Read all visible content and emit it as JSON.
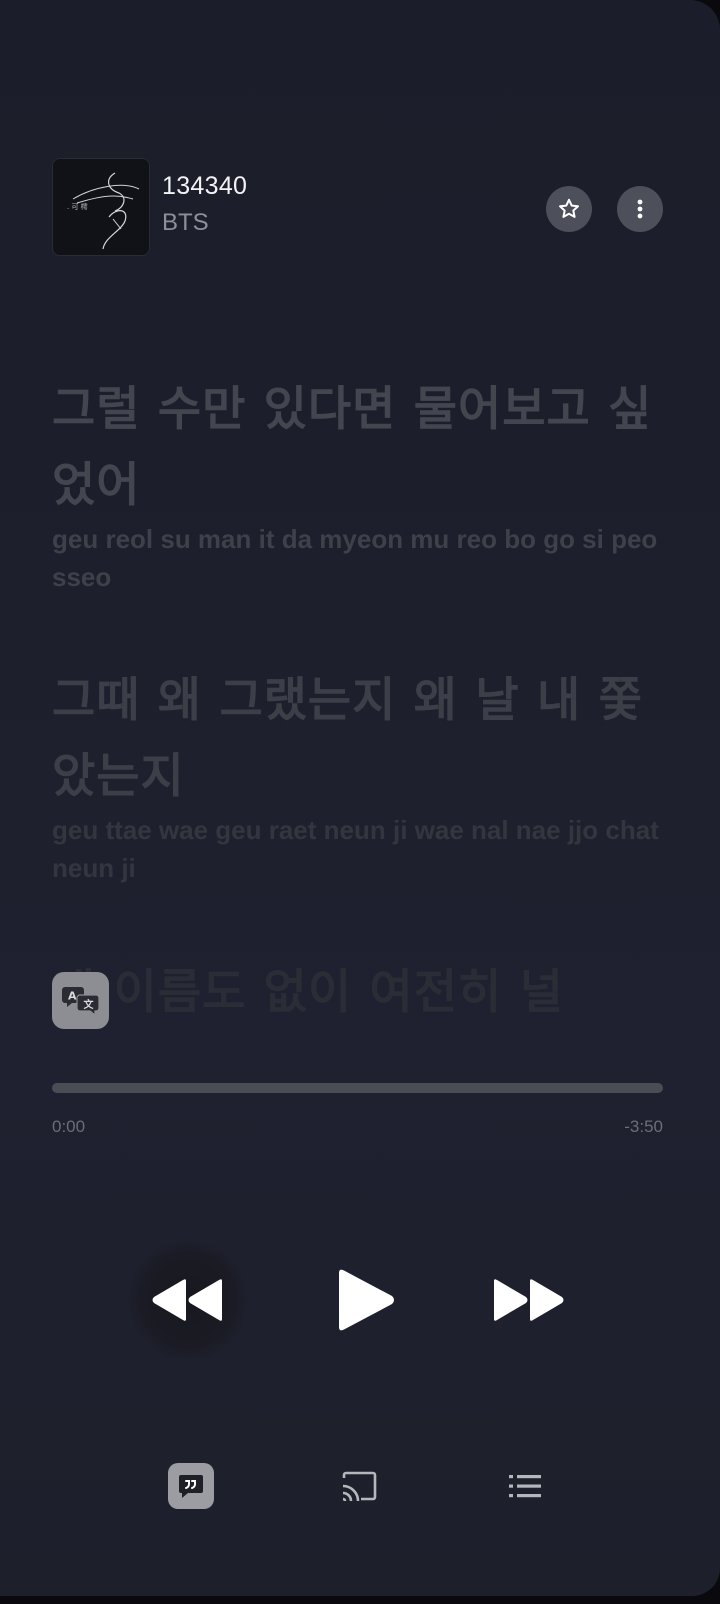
{
  "now_playing": {
    "title": "134340",
    "artist": "BTS"
  },
  "lyrics": [
    {
      "korean": "그럴 수만 있다면 물어보고 싶었어",
      "romanized": "geu reol  su man  it da myeon  mu reo bo go  si peo sseo"
    },
    {
      "korean": "그때 왜 그랬는지 왜 날 내 쫓았는지",
      "romanized": "geu ttae  wae  geu raet neun ji  wae  nal  nae jjo chat neun ji"
    },
    {
      "korean": "내 이름도 없이 여전히 널"
    }
  ],
  "progress": {
    "elapsed": "0:00",
    "remaining": "-3:50",
    "fraction": 0.0
  },
  "icons": {
    "favorite": "star-outline-icon",
    "more": "more-vertical-icon",
    "translate": "translate-icon",
    "previous": "rewind-icon",
    "play": "play-icon",
    "next": "fast-forward-icon",
    "lyrics": "lyrics-icon",
    "cast": "cast-icon",
    "queue": "queue-list-icon"
  },
  "colors": {
    "background": "#1d1f2c",
    "control_icon": "#ffffff",
    "active_tab": "#9c9da3"
  }
}
